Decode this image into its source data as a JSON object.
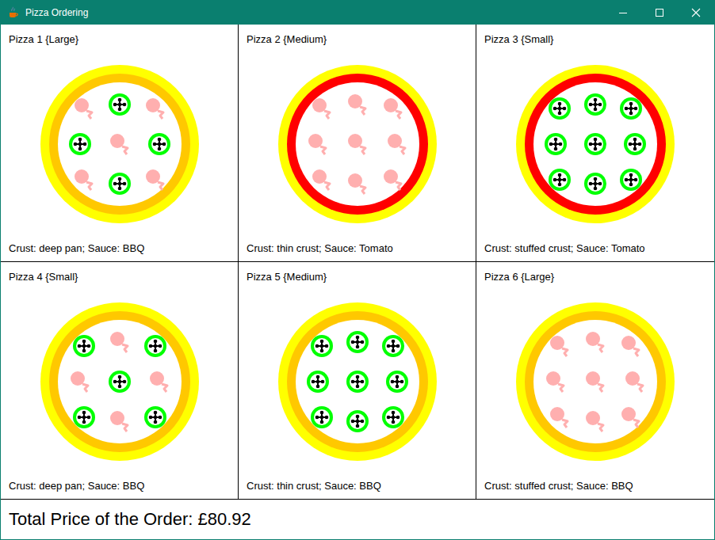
{
  "window": {
    "title": "Pizza Ordering"
  },
  "pizzas": [
    {
      "label": "Pizza 1 {Large}",
      "description": "Crust: deep pan; Sauce: BBQ",
      "color": "#FFC800",
      "toppings": [
        {
          "kind": "prawn"
        },
        {
          "kind": "pepper"
        },
        {
          "kind": "prawn"
        },
        {
          "kind": "pepper"
        },
        {
          "kind": "prawn"
        },
        {
          "kind": "pepper"
        },
        {
          "kind": "prawn"
        },
        {
          "kind": "pepper"
        },
        {
          "kind": "prawn"
        }
      ]
    },
    {
      "label": "Pizza 2 {Medium}",
      "description": "Crust: thin crust; Sauce: Tomato",
      "color": "#FF0000",
      "toppings": [
        {
          "kind": "prawn"
        },
        {
          "kind": "prawn"
        },
        {
          "kind": "prawn"
        },
        {
          "kind": "prawn"
        },
        {
          "kind": "prawn"
        },
        {
          "kind": "prawn"
        },
        {
          "kind": "prawn"
        },
        {
          "kind": "prawn"
        },
        {
          "kind": "prawn"
        }
      ]
    },
    {
      "label": "Pizza 3 {Small}",
      "description": "Crust: stuffed crust; Sauce: Tomato",
      "color": "#FF0000",
      "toppings": [
        {
          "kind": "pepper"
        },
        {
          "kind": "pepper"
        },
        {
          "kind": "pepper"
        },
        {
          "kind": "pepper"
        },
        {
          "kind": "pepper"
        },
        {
          "kind": "pepper"
        },
        {
          "kind": "pepper"
        },
        {
          "kind": "pepper"
        },
        {
          "kind": "pepper"
        }
      ]
    },
    {
      "label": "Pizza 4 {Small}",
      "description": "Crust: deep pan; Sauce: BBQ",
      "color": "#FFC800",
      "toppings": [
        {
          "kind": "pepper"
        },
        {
          "kind": "prawn"
        },
        {
          "kind": "pepper"
        },
        {
          "kind": "prawn"
        },
        {
          "kind": "pepper"
        },
        {
          "kind": "prawn"
        },
        {
          "kind": "pepper"
        },
        {
          "kind": "prawn"
        },
        {
          "kind": "pepper"
        }
      ]
    },
    {
      "label": "Pizza 5 {Medium}",
      "description": "Crust: thin crust; Sauce: BBQ",
      "color": "#FFC800",
      "toppings": [
        {
          "kind": "pepper"
        },
        {
          "kind": "pepper"
        },
        {
          "kind": "pepper"
        },
        {
          "kind": "pepper"
        },
        {
          "kind": "pepper"
        },
        {
          "kind": "pepper"
        },
        {
          "kind": "pepper"
        },
        {
          "kind": "pepper"
        },
        {
          "kind": "pepper"
        }
      ]
    },
    {
      "label": "Pizza 6 {Large}",
      "description": "Crust: stuffed crust; Sauce: BBQ",
      "color": "#FFC800",
      "toppings": [
        {
          "kind": "prawn"
        },
        {
          "kind": "prawn"
        },
        {
          "kind": "prawn"
        },
        {
          "kind": "prawn"
        },
        {
          "kind": "prawn"
        },
        {
          "kind": "prawn"
        },
        {
          "kind": "prawn"
        },
        {
          "kind": "prawn"
        },
        {
          "kind": "prawn"
        }
      ]
    }
  ],
  "total": "Total Price of the Order: £80.92"
}
